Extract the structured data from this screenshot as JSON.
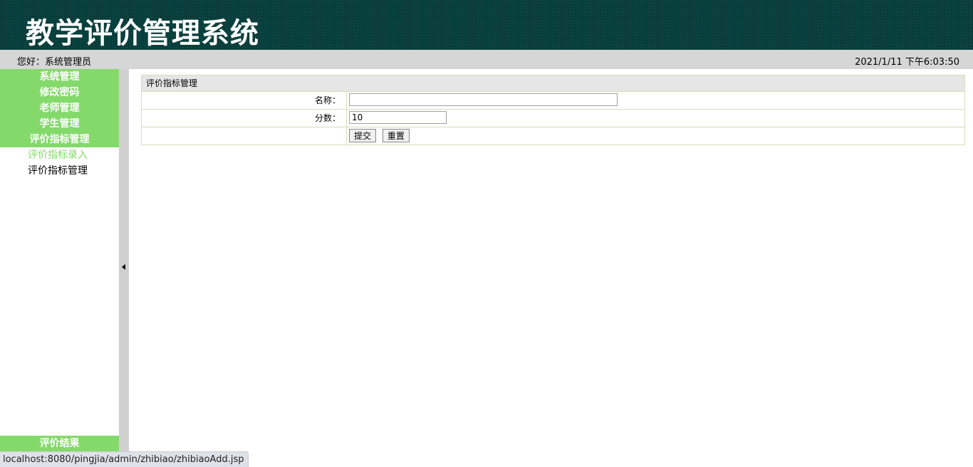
{
  "header": {
    "title": "教学评价管理系统"
  },
  "infobar": {
    "greeting": "您好：系统管理员",
    "datetime": "2021/1/11 下午6:03:50"
  },
  "sidebar": {
    "items": [
      {
        "label": "系统管理"
      },
      {
        "label": "修改密码"
      },
      {
        "label": "老师管理"
      },
      {
        "label": "学生管理"
      },
      {
        "label": "评价指标管理"
      }
    ],
    "sub_items": [
      {
        "label": "评价指标录入",
        "active": true
      },
      {
        "label": "评价指标管理",
        "active": false
      }
    ],
    "bottom_item": "评价结果"
  },
  "form": {
    "title": "评价指标管理",
    "name_label": "名称：",
    "name_value": "",
    "score_label": "分数：",
    "score_value": "10",
    "submit_label": "提交",
    "reset_label": "重置"
  },
  "statusbar": {
    "url": "localhost:8080/pingjia/admin/zhibiao/zhibiaoAdd.jsp"
  },
  "colors": {
    "banner": "#06403d",
    "menu": "#84d96b",
    "infobar": "#d6d6d6"
  }
}
